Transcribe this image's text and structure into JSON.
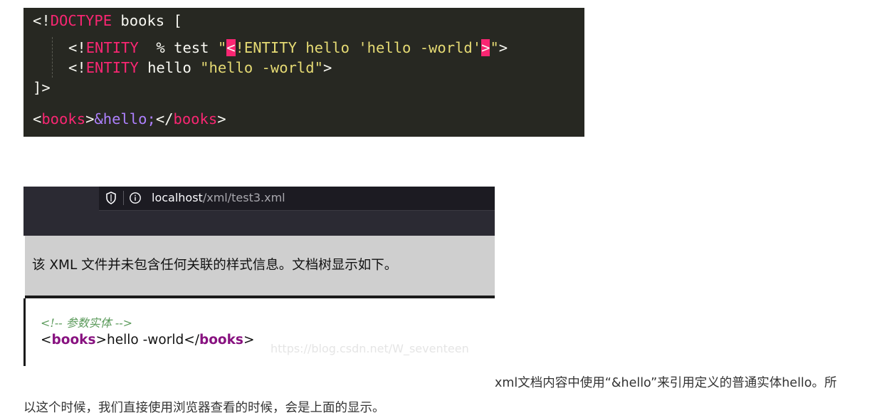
{
  "editor": {
    "line1": {
      "p1": "<!",
      "kw": "DOCTYPE",
      "p2": " books ["
    },
    "line2": {
      "p1": "<!",
      "kw": "ENTITY",
      "p2": "  % test ",
      "q1": "\"",
      "lt": "<",
      "str": "!ENTITY hello 'hello -world'",
      "gt": ">",
      "q2": "\"",
      "p3": ">"
    },
    "line3": {
      "p1": "<!",
      "kw": "ENTITY",
      "p2": " hello ",
      "str": "\"hello -world\"",
      "p3": ">"
    },
    "line4": {
      "text": "]>"
    },
    "line5": {
      "open_lt": "<",
      "open_tag": "books",
      "open_gt": ">",
      "entity": "&hello;",
      "close_lt": "</",
      "close_tag": "books",
      "close_gt": ">"
    }
  },
  "browser": {
    "url_host": "localhost",
    "url_path": "/xml/test3.xml",
    "info_message": "该 XML 文件并未包含任何关联的样式信息。文档树显示如下。",
    "comment": "<!-- 参数实体 -->",
    "xml": {
      "lt1": "<",
      "tag1": "books",
      "gt1": ">",
      "content": "hello -world",
      "lt2": "</",
      "tag2": "books",
      "gt2": ">"
    },
    "watermark": "https://blog.csdn.net/W_seventeen"
  },
  "article": {
    "para_line1": "xml文档内容中使用“&hello”来引用定义的普通实体hello。所",
    "para_line2": "以这个时候，我们直接使用浏览器查看的时候，会是上面的显示。"
  },
  "colors": {
    "editor_bg": "#272822",
    "keyword": "#f92672",
    "string": "#e6db74",
    "entity": "#ae81ff",
    "xml_tag": "#881280",
    "comment": "#5a9a5a"
  }
}
